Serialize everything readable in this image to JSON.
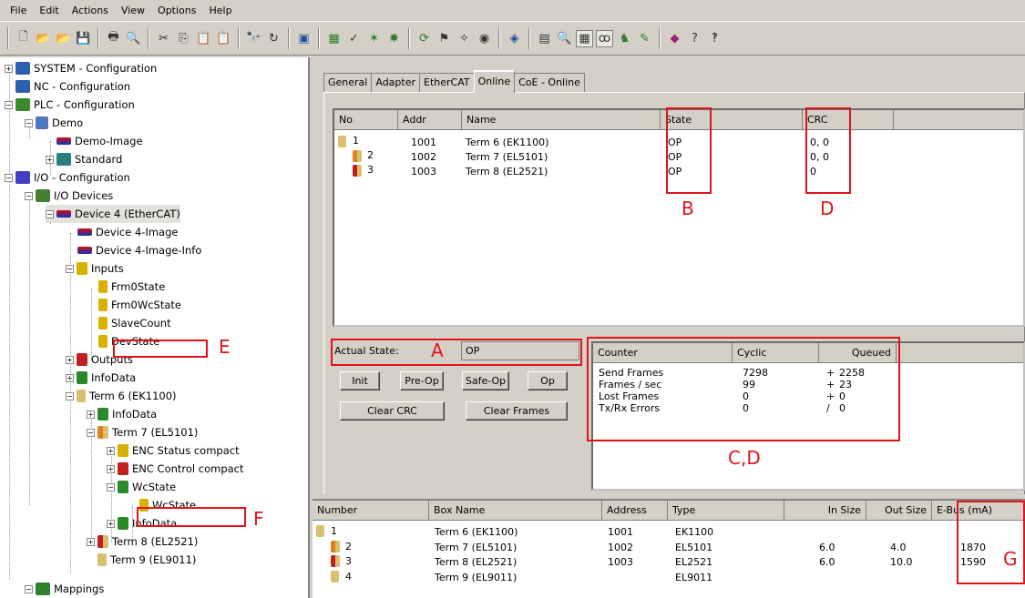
{
  "menu": [
    "File",
    "Edit",
    "Actions",
    "View",
    "Options",
    "Help"
  ],
  "toolbar_icons": [
    "new-icon",
    "open-icon",
    "open-project-icon",
    "save-icon",
    "print-icon",
    "preview-icon",
    "cut-icon",
    "copy-icon",
    "paste-icon",
    "paste-special-icon",
    "find-icon",
    "find-next-icon",
    "monitor-icon",
    "io-icon",
    "check-icon",
    "activate-icon",
    "plc-icon",
    "restart-icon",
    "config-icon",
    "scan-icon",
    "free-run-icon",
    "settings-icon",
    "editor-icon",
    "zoom-icon",
    "grid-icon",
    "watch-icon",
    "graph-icon",
    "ads-icon",
    "book-icon",
    "help-icon",
    "whatsthis-icon"
  ],
  "tree": [
    {
      "label": "SYSTEM - Configuration"
    },
    {
      "label": "NC - Configuration"
    },
    {
      "label": "PLC - Configuration"
    },
    {
      "label": "Demo"
    },
    {
      "label": "Demo-Image"
    },
    {
      "label": "Standard"
    },
    {
      "label": "I/O - Configuration"
    },
    {
      "label": "I/O Devices"
    },
    {
      "label": "Device 4 (EtherCAT)"
    },
    {
      "label": "Device 4-Image"
    },
    {
      "label": "Device 4-Image-Info"
    },
    {
      "label": "Inputs"
    },
    {
      "label": "Frm0State"
    },
    {
      "label": "Frm0WcState"
    },
    {
      "label": "SlaveCount"
    },
    {
      "label": "DevState"
    },
    {
      "label": "Outputs"
    },
    {
      "label": "InfoData"
    },
    {
      "label": "Term 6 (EK1100)"
    },
    {
      "label": "InfoData"
    },
    {
      "label": "Term 7 (EL5101)"
    },
    {
      "label": "ENC Status compact"
    },
    {
      "label": "ENC Control compact"
    },
    {
      "label": "WcState"
    },
    {
      "label": "WcState"
    },
    {
      "label": "InfoData"
    },
    {
      "label": "Term 8 (EL2521)"
    },
    {
      "label": "Term 9 (EL9011)"
    },
    {
      "label": "Mappings"
    }
  ],
  "tabs": [
    "General",
    "Adapter",
    "EtherCAT",
    "Online",
    "CoE - Online"
  ],
  "online_table": {
    "headers": [
      "No",
      "Addr",
      "Name",
      "State",
      "CRC"
    ],
    "rows": [
      {
        "no": "1",
        "addr": "1001",
        "name": "Term 6 (EK1100)",
        "state": "OP",
        "crc": "0, 0"
      },
      {
        "no": "2",
        "addr": "1002",
        "name": "Term 7 (EL5101)",
        "state": "OP",
        "crc": "0, 0"
      },
      {
        "no": "3",
        "addr": "1003",
        "name": "Term 8 (EL2521)",
        "state": "OP",
        "crc": "0"
      }
    ]
  },
  "actual_state": {
    "label": "Actual State:",
    "value": "OP"
  },
  "buttons": {
    "init": "Init",
    "preop": "Pre-Op",
    "safeop": "Safe-Op",
    "op": "Op",
    "clear_crc": "Clear CRC",
    "clear_frames": "Clear Frames"
  },
  "counter_table": {
    "headers": [
      "Counter",
      "Cyclic",
      "Queued"
    ],
    "rows": [
      {
        "name": "Send Frames",
        "cyclic": "7298",
        "sep": "+",
        "queued": "2258"
      },
      {
        "name": "Frames / sec",
        "cyclic": "99",
        "sep": "+",
        "queued": "23"
      },
      {
        "name": "Lost Frames",
        "cyclic": "0",
        "sep": "+",
        "queued": "0"
      },
      {
        "name": "Tx/Rx Errors",
        "cyclic": "0",
        "sep": "/",
        "queued": "0"
      }
    ]
  },
  "annotations": {
    "a": "A",
    "b": "B",
    "cd": "C,D",
    "d": "D",
    "e": "E",
    "f": "F",
    "g": "G"
  },
  "bottom_table": {
    "headers": [
      "Number",
      "Box Name",
      "Address",
      "Type",
      "In Size",
      "Out Size",
      "E-Bus (mA)"
    ],
    "rows": [
      {
        "number": "1",
        "box": "Term 6 (EK1100)",
        "address": "1001",
        "type": "EK1100",
        "in": "",
        "out": "",
        "ebus": ""
      },
      {
        "number": "2",
        "box": "Term 7 (EL5101)",
        "address": "1002",
        "type": "EL5101",
        "in": "6.0",
        "out": "4.0",
        "ebus": "1870"
      },
      {
        "number": "3",
        "box": "Term 8 (EL2521)",
        "address": "1003",
        "type": "EL2521",
        "in": "6.0",
        "out": "10.0",
        "ebus": "1590"
      },
      {
        "number": "4",
        "box": "Term 9 (EL9011)",
        "address": "",
        "type": "EL9011",
        "in": "",
        "out": "",
        "ebus": ""
      }
    ]
  },
  "colors": {
    "red_annotation": "#e0131a",
    "selection": "#d4d0c8"
  }
}
